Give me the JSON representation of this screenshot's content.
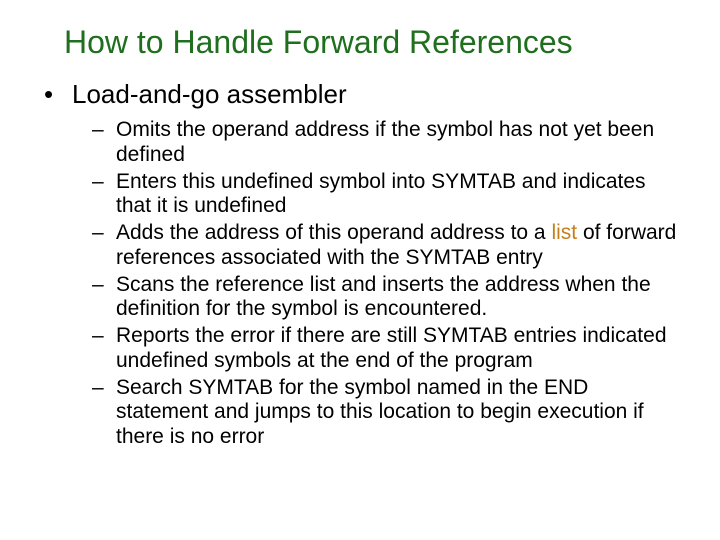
{
  "title": "How to Handle Forward References",
  "bullet1": "Load-and-go assembler",
  "sub": {
    "a": "Omits the operand address if the symbol has not yet been defined",
    "b": "Enters this undefined symbol into SYMTAB and indicates that it is undefined",
    "c_pre": "Adds the address of this operand address to a ",
    "c_hl": "list",
    "c_post": " of forward references associated with the SYMTAB entry",
    "d": "Scans the reference list and inserts the address when the definition for the symbol is encountered.",
    "e": "Reports the error if there are still SYMTAB entries indicated undefined symbols at the end of the program",
    "f": "Search SYMTAB for the symbol named in the END statement and jumps to this location to begin execution if there is no error"
  },
  "marks": {
    "dot": "•",
    "dash": "–"
  }
}
